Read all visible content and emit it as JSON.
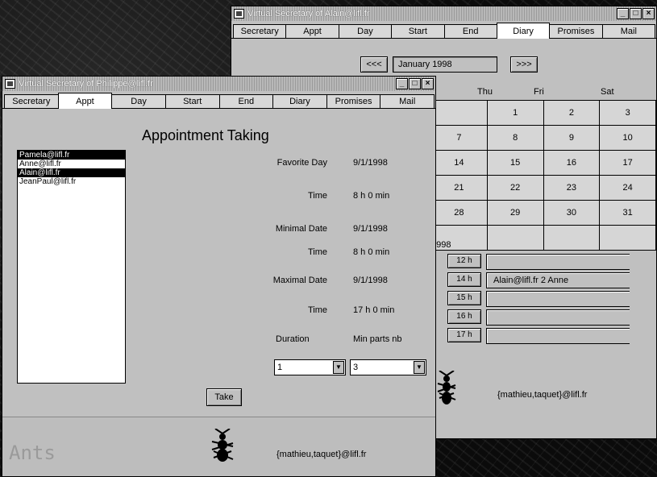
{
  "back_window": {
    "title": "Virtual Secretary of Alain@lifl.fr",
    "controls": [
      "_",
      "□",
      "×"
    ],
    "tabs": [
      "Secretary",
      "Appt",
      "Day",
      "Start",
      "End",
      "Diary",
      "Promises",
      "Mail"
    ],
    "active_tab": 5,
    "nav": {
      "prev": "<<<",
      "month": "January 1998",
      "next": ">>>"
    },
    "day_headers": [
      "Thu",
      "Fri",
      "Sat"
    ],
    "calendar_rows": [
      [
        "",
        "1",
        "2",
        "3"
      ],
      [
        "7",
        "8",
        "9",
        "10"
      ],
      [
        "14",
        "15",
        "16",
        "17"
      ],
      [
        "21",
        "22",
        "23",
        "24"
      ],
      [
        "28",
        "29",
        "30",
        "31"
      ],
      [
        "",
        "",
        "",
        ""
      ]
    ],
    "year_label": "1998",
    "slots": [
      {
        "hour": "12 h",
        "text": ""
      },
      {
        "hour": "14 h",
        "text": "Alain@lifl.fr 2 Anne"
      },
      {
        "hour": "15 h",
        "text": ""
      },
      {
        "hour": "16 h",
        "text": ""
      },
      {
        "hour": "17 h",
        "text": ""
      }
    ],
    "email": "{mathieu,taquet}@lifl.fr"
  },
  "front_window": {
    "title": "Virtual Secretary of Philippe@lifl.fr",
    "controls": [
      "_",
      "□",
      "×"
    ],
    "tabs": [
      "Secretary",
      "Appt",
      "Day",
      "Start",
      "End",
      "Diary",
      "Promises",
      "Mail"
    ],
    "active_tab": 1,
    "heading": "Appointment Taking",
    "users": [
      {
        "name": "Pamela@lifl.fr",
        "selected": true
      },
      {
        "name": "Anne@lifl.fr",
        "selected": false
      },
      {
        "name": "Alain@lifl.fr",
        "selected": true
      },
      {
        "name": "JeanPaul@lifl.fr",
        "selected": false
      }
    ],
    "favorite_day_label": "Favorite Day",
    "favorite_day_value": "9/1/1998",
    "time1_label": "Time",
    "time1_value": "8 h 0 min",
    "minimal_date_label": "Minimal Date",
    "minimal_date_value": "9/1/1998",
    "time2_label": "Time",
    "time2_value": "8 h 0 min",
    "maximal_date_label": "Maximal Date",
    "maximal_date_value": "9/1/1998",
    "time3_label": "Time",
    "time3_value": "17 h 0 min",
    "duration_label": "Duration",
    "min_parts_label": "Min parts nb",
    "duration_value": "1",
    "min_parts_value": "3",
    "take_button": "Take",
    "logo_text": "Ants",
    "email": "{mathieu,taquet}@lifl.fr"
  }
}
